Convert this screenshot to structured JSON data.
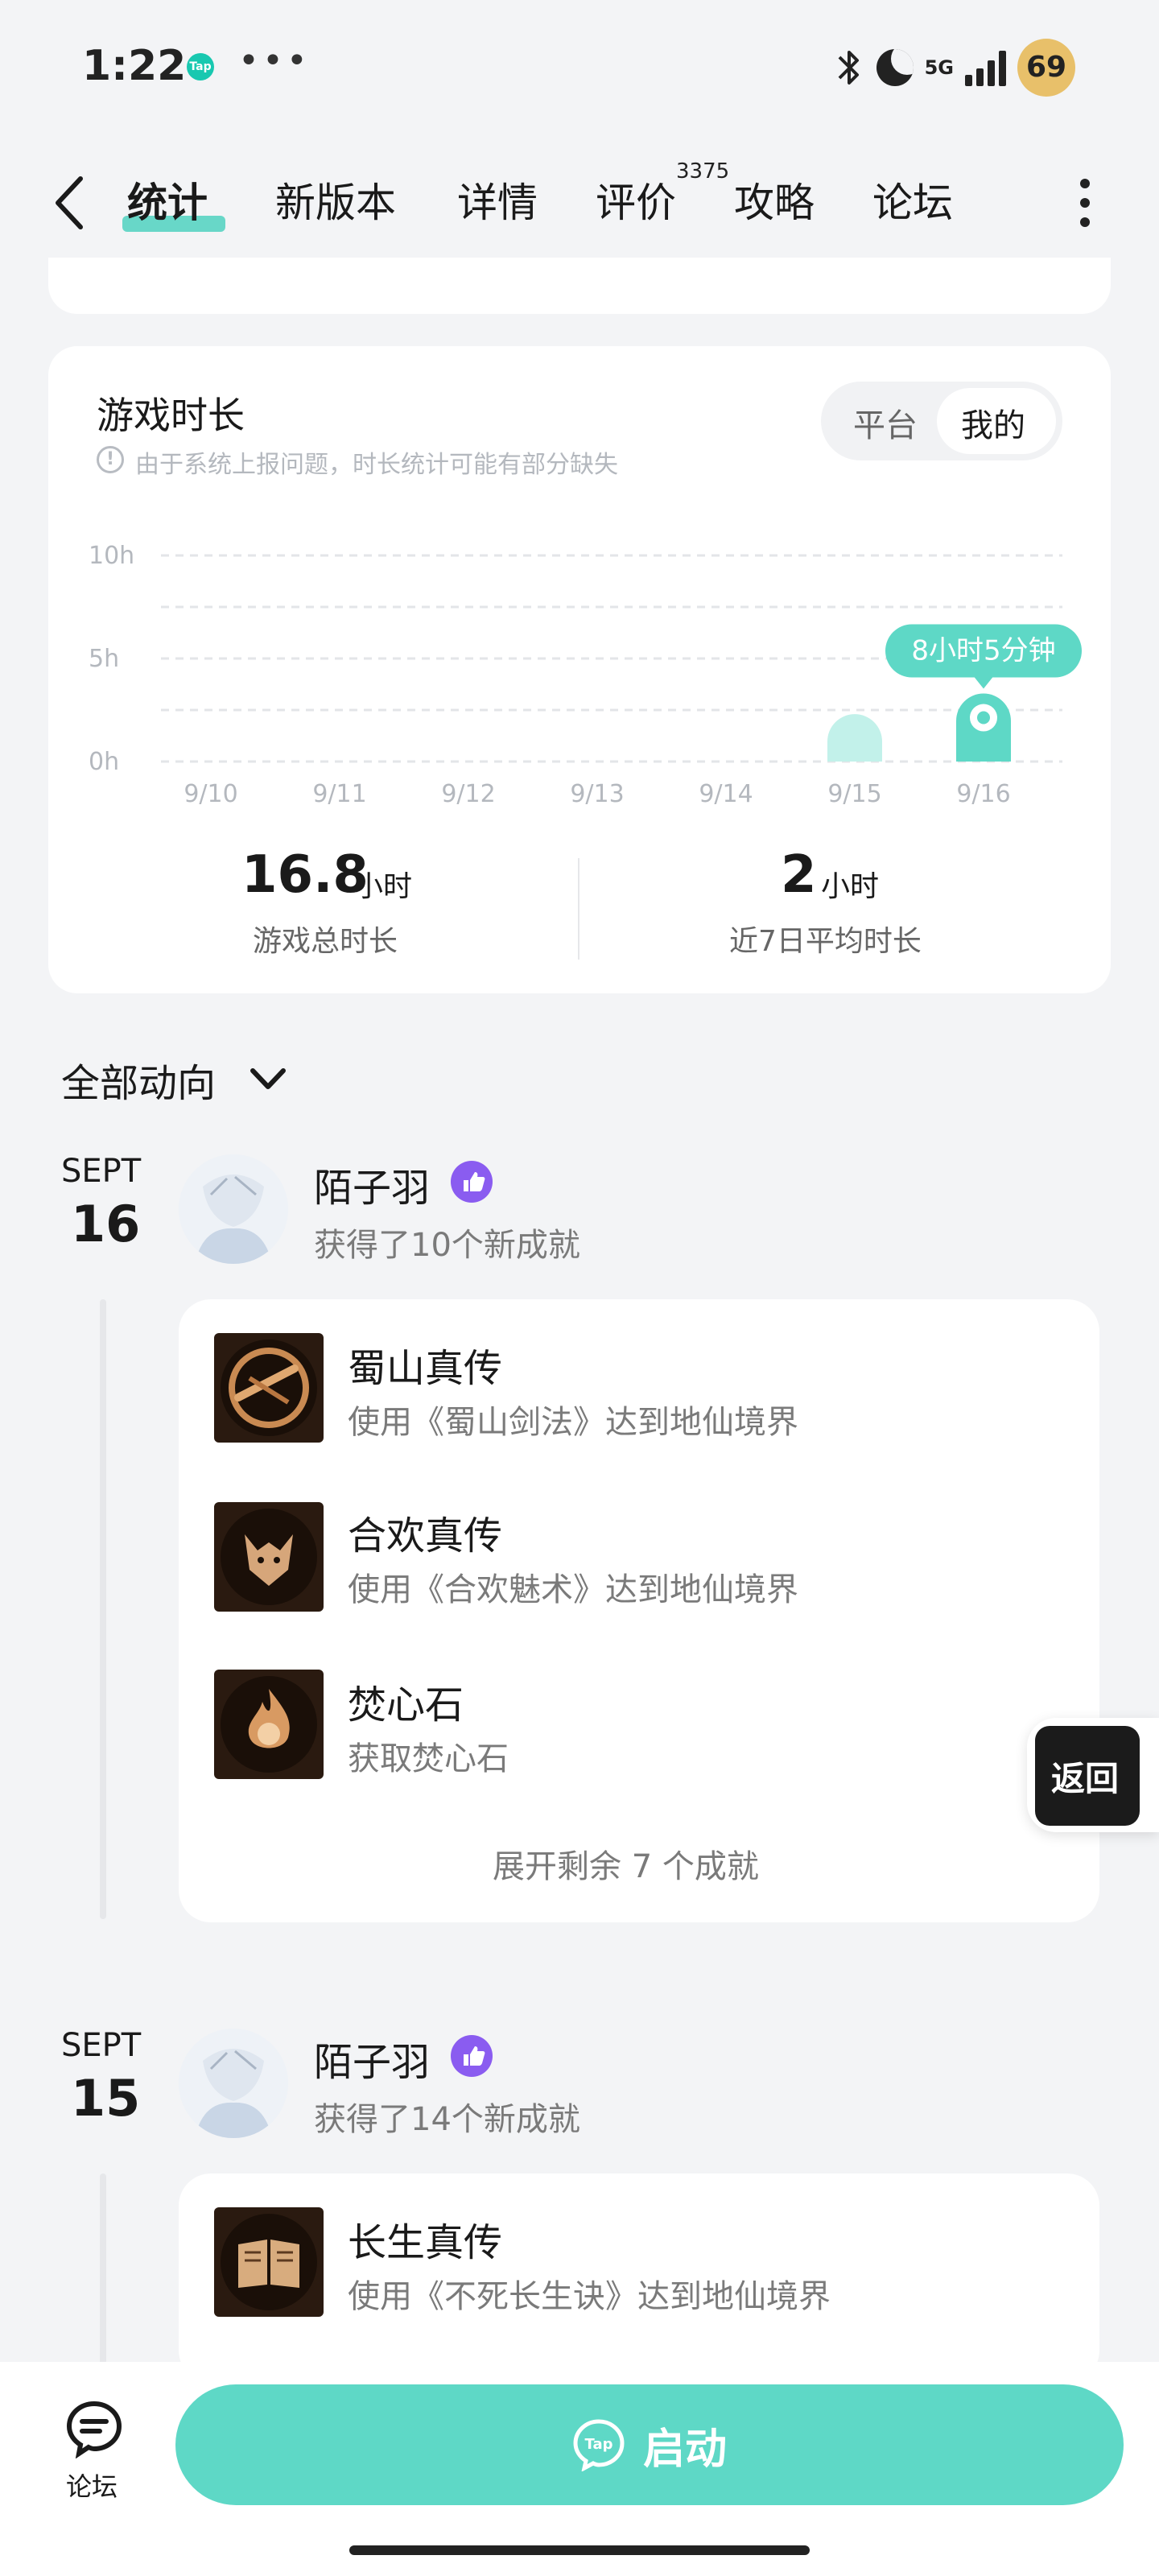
{
  "status_bar": {
    "time": "1:22",
    "app_badge": "Tap",
    "dots": "•••",
    "network": "5G",
    "battery": "69"
  },
  "nav": {
    "tabs": [
      {
        "label": "统计",
        "active": true
      },
      {
        "label": "新版本",
        "active": false
      },
      {
        "label": "详情",
        "active": false
      },
      {
        "label": "评价",
        "active": false
      },
      {
        "label": "攻略",
        "active": false
      },
      {
        "label": "论坛",
        "active": false
      }
    ],
    "review_count": "3375"
  },
  "stats": {
    "title": "游戏时长",
    "note": "由于系统上报问题，时长统计可能有部分缺失",
    "segment": {
      "platform": "平台",
      "mine": "我的"
    },
    "total_value": "16.8",
    "total_unit": "小时",
    "total_label": "游戏总时长",
    "avg_value": "2",
    "avg_unit": "小时",
    "avg_label": "近7日平均时长"
  },
  "chart_data": {
    "type": "bar",
    "categories": [
      "9/10",
      "9/11",
      "9/12",
      "9/13",
      "9/14",
      "9/15",
      "9/16"
    ],
    "values": [
      0,
      0,
      0,
      0,
      0,
      2.3,
      3.3
    ],
    "ylim": [
      0,
      10
    ],
    "yticks": [
      "10h",
      "5h",
      "0h"
    ],
    "highlight_label": "8小时5分钟",
    "highlight_index": 6,
    "colors": {
      "bar": "#c2f1ea",
      "highlight": "#5ed8c6"
    },
    "grid": true
  },
  "feed": {
    "filter_label": "全部动向",
    "entries": [
      {
        "month": "SEPT",
        "day": "16",
        "user": "陌子羽",
        "summary": "获得了10个新成就",
        "achievements": [
          {
            "title": "蜀山真传",
            "desc": "使用《蜀山剑法》达到地仙境界",
            "icon": "sword-emblem-icon"
          },
          {
            "title": "合欢真传",
            "desc": "使用《合欢魅术》达到地仙境界",
            "icon": "fox-emblem-icon"
          },
          {
            "title": "焚心石",
            "desc": "获取焚心石",
            "icon": "fire-stone-icon"
          }
        ],
        "expand": "展开剩余 7 个成就"
      },
      {
        "month": "SEPT",
        "day": "15",
        "user": "陌子羽",
        "summary": "获得了14个新成就",
        "achievements": [
          {
            "title": "长生真传",
            "desc": "使用《不死长生诀》达到地仙境界",
            "icon": "book-emblem-icon"
          }
        ]
      }
    ]
  },
  "return_button": "返回",
  "bottom_bar": {
    "forum_label": "论坛",
    "launch_label": "启动"
  }
}
